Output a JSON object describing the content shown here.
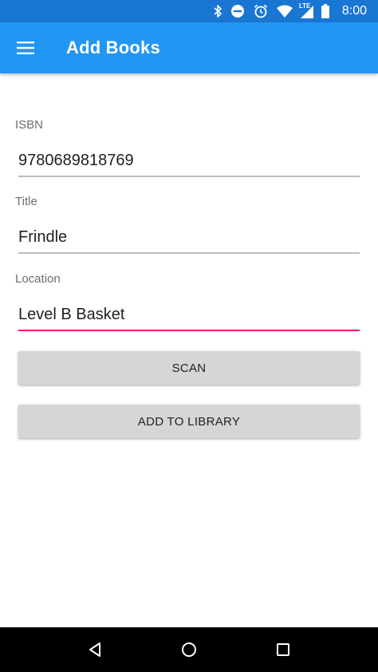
{
  "status_bar": {
    "time": "8:00",
    "icons": [
      "bluetooth-icon",
      "do-not-disturb-icon",
      "alarm-icon",
      "wifi-icon",
      "lte-signal-icon",
      "battery-icon"
    ],
    "lte_label": "LTE"
  },
  "app_bar": {
    "title": "Add Books",
    "menu_icon": "hamburger-menu-icon",
    "color": "#2196F3"
  },
  "form": {
    "isbn": {
      "label": "ISBN",
      "value": "9780689818769"
    },
    "title": {
      "label": "Title",
      "value": "Frindle"
    },
    "location": {
      "label": "Location",
      "value": "Level B Basket",
      "focused": true,
      "accent": "#E91E63"
    }
  },
  "buttons": {
    "scan": "SCAN",
    "add_to_library": "ADD TO LIBRARY"
  },
  "nav_bar": {
    "icons": [
      "back-icon",
      "home-icon",
      "recents-icon"
    ]
  }
}
